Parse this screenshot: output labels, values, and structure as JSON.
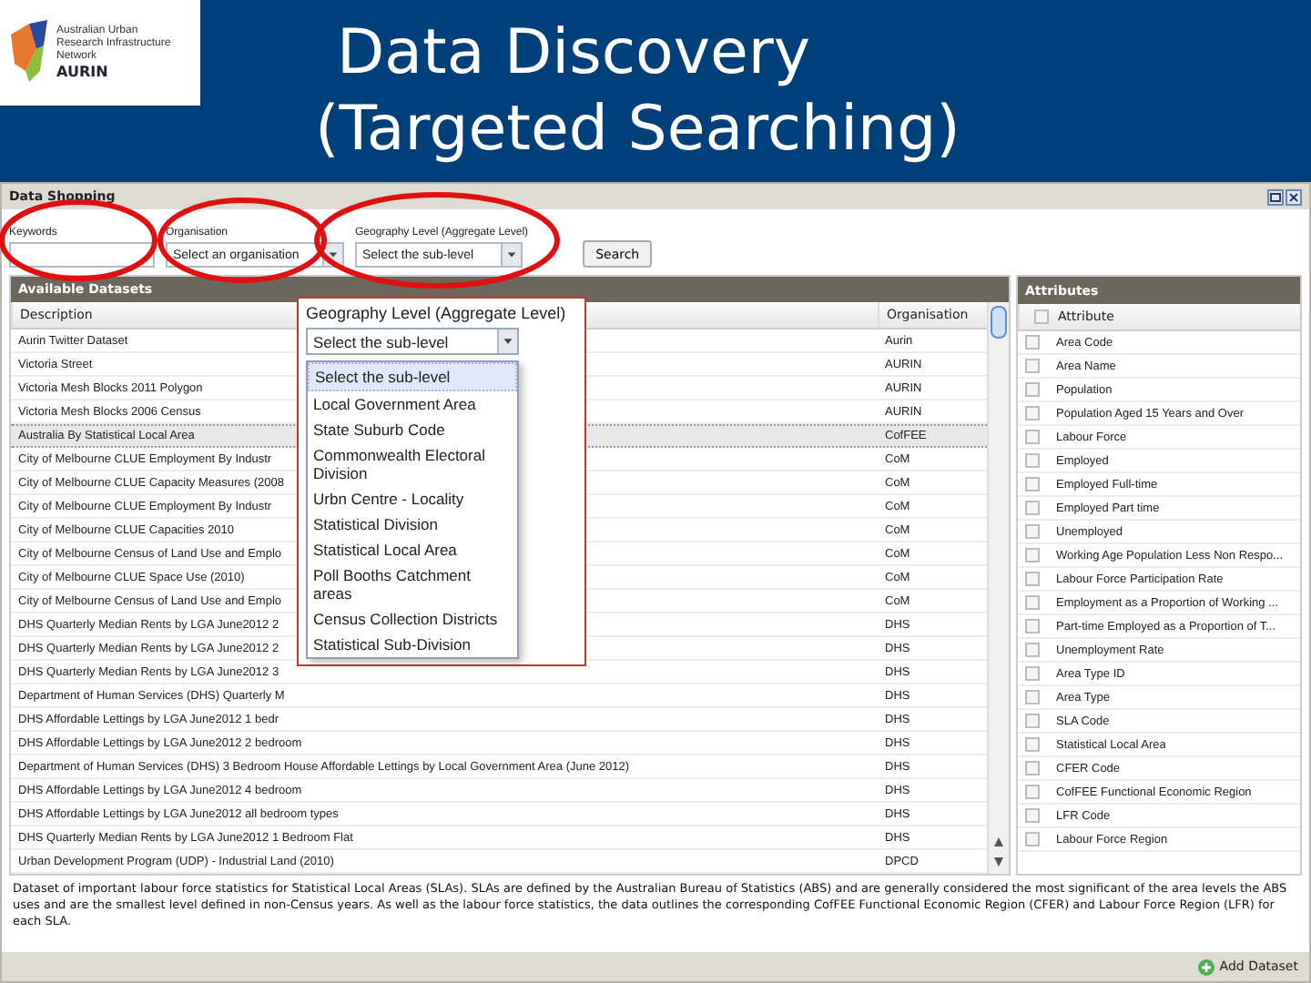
{
  "slide": {
    "logo_name": "AURIN",
    "logo_tagline": "Australian Urban Research Infrastructure Network",
    "title_lines": [
      "Data Discovery",
      "(Targeted Searching)"
    ]
  },
  "window": {
    "title": "Data Shopping"
  },
  "form": {
    "fields": [
      {
        "label": "Keywords",
        "kind": "text"
      },
      {
        "label": "Organisation",
        "kind": "select",
        "value": "Select an organisation"
      },
      {
        "label": "Geography Level (Aggregate Level)",
        "kind": "select",
        "value": "Select the sub-level"
      }
    ],
    "search_button": "Search"
  },
  "datasets": {
    "title": "Available Datasets",
    "columns": [
      "Description",
      "Organisation"
    ],
    "rows": [
      {
        "description": "Aurin Twitter Dataset",
        "organisation": "Aurin",
        "selected": false
      },
      {
        "description": "Victoria Street",
        "organisation": "AURIN",
        "selected": false
      },
      {
        "description": "Victoria Mesh Blocks 2011 Polygon",
        "organisation": "AURIN",
        "selected": false
      },
      {
        "description": "Victoria Mesh Blocks 2006 Census",
        "organisation": "AURIN",
        "selected": false
      },
      {
        "description": "Australia By Statistical Local Area",
        "organisation": "CofFEE",
        "selected": true
      },
      {
        "description": "City of Melbourne CLUE Employment By Industr",
        "organisation": "CoM",
        "selected": false
      },
      {
        "description": "City of Melbourne CLUE Capacity Measures (2008",
        "organisation": "CoM",
        "selected": false
      },
      {
        "description": "City of Melbourne CLUE Employment By Industr",
        "organisation": "CoM",
        "selected": false
      },
      {
        "description": "City of Melbourne CLUE Capacities 2010",
        "organisation": "CoM",
        "selected": false
      },
      {
        "description": "City of Melbourne Census of Land Use and Emplo",
        "organisation": "CoM",
        "selected": false
      },
      {
        "description": "City of Melbourne CLUE Space Use (2010)",
        "organisation": "CoM",
        "selected": false
      },
      {
        "description": "City of Melbourne Census of Land Use and Emplo",
        "organisation": "CoM",
        "selected": false
      },
      {
        "description": "DHS Quarterly Median Rents by LGA June2012 2",
        "organisation": "DHS",
        "selected": false
      },
      {
        "description": "DHS Quarterly Median Rents by LGA June2012 2",
        "organisation": "DHS",
        "selected": false
      },
      {
        "description": "DHS Quarterly Median Rents by LGA June2012 3",
        "organisation": "DHS",
        "selected": false
      },
      {
        "description": "Department of Human Services (DHS) Quarterly M",
        "organisation": "DHS",
        "selected": false
      },
      {
        "description": "DHS Affordable Lettings by LGA June2012 1 bedr",
        "organisation": "DHS",
        "selected": false
      },
      {
        "description": "DHS Affordable Lettings by LGA June2012 2 bedroom",
        "organisation": "DHS",
        "selected": false
      },
      {
        "description": "Department of Human Services (DHS) 3 Bedroom House Affordable Lettings by Local Government Area (June 2012)",
        "organisation": "DHS",
        "selected": false
      },
      {
        "description": "DHS Affordable Lettings by LGA June2012 4 bedroom",
        "organisation": "DHS",
        "selected": false
      },
      {
        "description": "DHS Affordable Lettings by LGA June2012 all bedroom types",
        "organisation": "DHS",
        "selected": false
      },
      {
        "description": "DHS Quarterly Median Rents by LGA June2012 1 Bedroom Flat",
        "organisation": "DHS",
        "selected": false
      },
      {
        "description": "Urban Development Program (UDP) - Industrial Land (2010)",
        "organisation": "DPCD",
        "selected": false
      }
    ]
  },
  "attributes": {
    "title": "Attributes",
    "column": "Attribute",
    "all_checked": false,
    "rows": [
      {
        "label": "Area Code",
        "checked": false
      },
      {
        "label": "Area Name",
        "checked": false
      },
      {
        "label": "Population",
        "checked": false
      },
      {
        "label": "Population Aged 15 Years and Over",
        "checked": false
      },
      {
        "label": "Labour Force",
        "checked": false
      },
      {
        "label": "Employed",
        "checked": false
      },
      {
        "label": "Employed Full-time",
        "checked": false
      },
      {
        "label": "Employed Part time",
        "checked": false
      },
      {
        "label": "Unemployed",
        "checked": false
      },
      {
        "label": "Working Age Population Less Non Respo...",
        "checked": false
      },
      {
        "label": "Labour Force Participation Rate",
        "checked": false
      },
      {
        "label": "Employment as a Proportion of Working ...",
        "checked": false
      },
      {
        "label": "Part-time Employed as a Proportion of T...",
        "checked": false
      },
      {
        "label": "Unemployment Rate",
        "checked": false
      },
      {
        "label": "Area Type ID",
        "checked": false
      },
      {
        "label": "Area Type",
        "checked": false
      },
      {
        "label": "SLA Code",
        "checked": false
      },
      {
        "label": "Statistical Local Area",
        "checked": false
      },
      {
        "label": "CFER Code",
        "checked": false
      },
      {
        "label": "CofFEE Functional Economic Region",
        "checked": false
      },
      {
        "label": "LFR Code",
        "checked": false
      },
      {
        "label": "Labour Force Region",
        "checked": false
      }
    ]
  },
  "popup": {
    "title": "Geography Level (Aggregate Level)",
    "select_value": "Select the sub-level",
    "options": [
      {
        "label": "Select the sub-level",
        "selected": true
      },
      {
        "label": "Local Government Area",
        "selected": false
      },
      {
        "label": "State Suburb Code",
        "selected": false
      },
      {
        "label": "Commonwealth Electoral Division",
        "selected": false
      },
      {
        "label": "Urbn Centre - Locality",
        "selected": false
      },
      {
        "label": "Statistical Division",
        "selected": false
      },
      {
        "label": "Statistical Local Area",
        "selected": false
      },
      {
        "label": "Poll Booths Catchment areas",
        "selected": false
      },
      {
        "label": "Census Collection Districts",
        "selected": false
      },
      {
        "label": "Statistical Sub-Division",
        "selected": false
      }
    ]
  },
  "description": "Dataset of important labour force statistics for Statistical Local Areas (SLAs). SLAs are defined by the Australian Bureau of Statistics (ABS) and are generally considered the most significant of the area levels the ABS uses and are the smallest level defined in non-Census years. As well as the labour force statistics, the data outlines the corresponding CofFEE Functional Economic Region (CFER) and Labour Force Region (LFR) for each SLA.",
  "add_button": "Add Dataset"
}
